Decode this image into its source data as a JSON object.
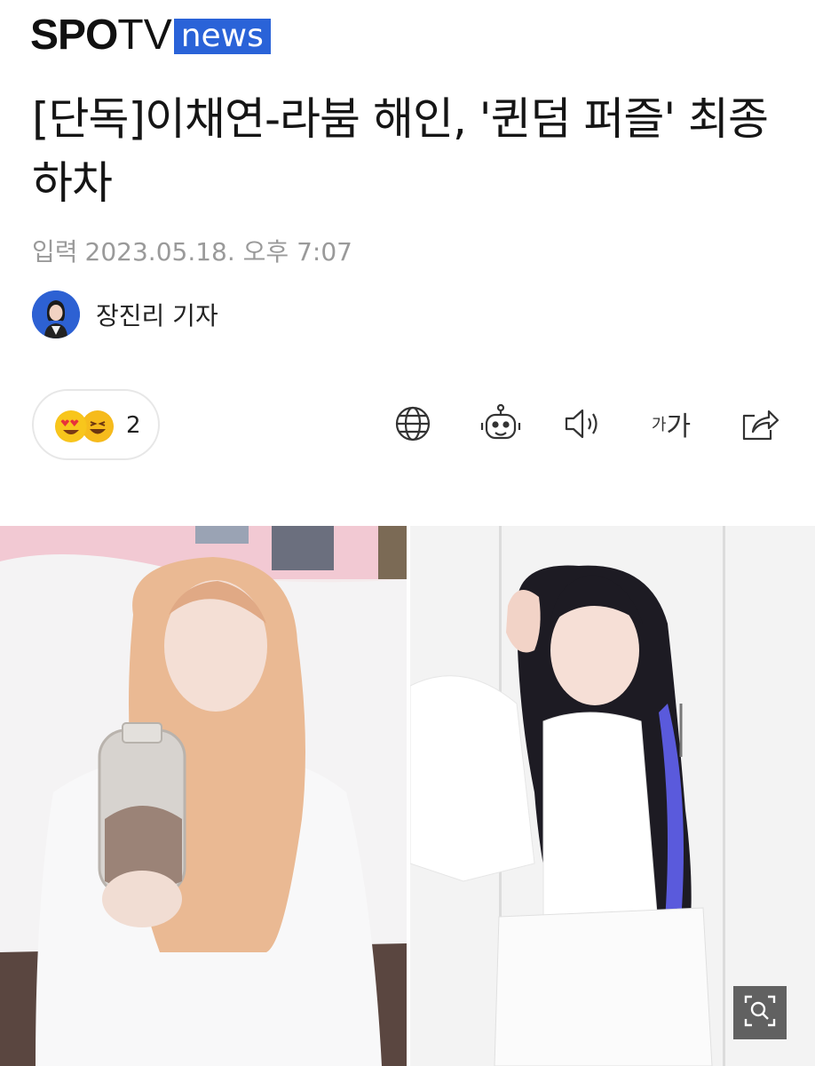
{
  "logo": {
    "spo": "SPO",
    "tv": "TV",
    "news": "news",
    "news_color": "#2a63d8"
  },
  "article": {
    "headline": "[단독]이채연-라붐 해인, '퀸덤 퍼즐' 최종 하차",
    "date_label": "입력",
    "date_value": "2023.05.18. 오후 7:07",
    "author_name": "장진리 기자"
  },
  "reactions": {
    "count": "2",
    "emojis": [
      "heart-eyes-emoji",
      "laughing-emoji"
    ]
  },
  "toolbar": {
    "icons": [
      "globe-icon",
      "robot-icon",
      "speaker-icon",
      "font-size-icon",
      "share-icon"
    ],
    "font_small": "가",
    "font_big": "가"
  },
  "photos": {
    "left": "photo-lee-chaeyeon",
    "right": "photo-haein"
  }
}
